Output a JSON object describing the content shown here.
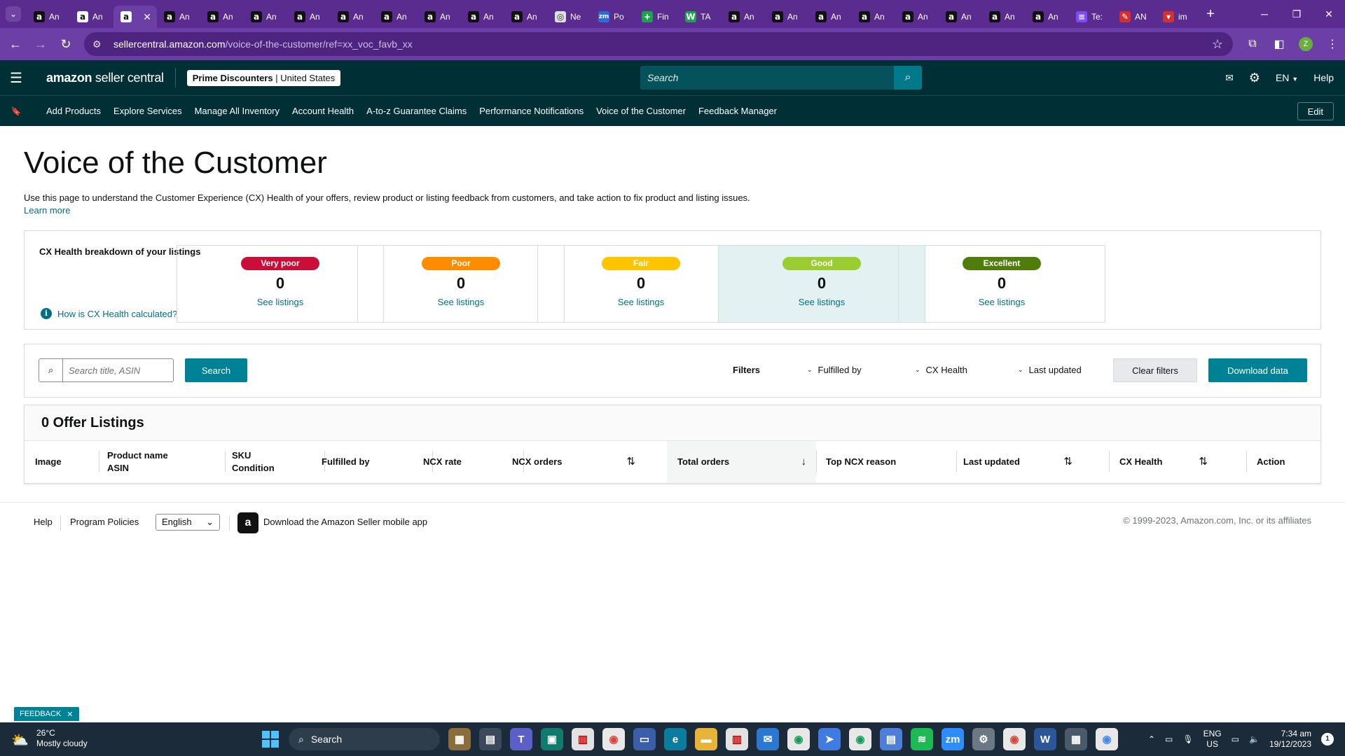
{
  "browser": {
    "tabs": [
      {
        "label": "An",
        "fav": "a",
        "style": "dark",
        "active": false
      },
      {
        "label": "An",
        "fav": "a",
        "style": "",
        "active": false
      },
      {
        "label": "",
        "fav": "a",
        "style": "",
        "active": true
      },
      {
        "label": "An",
        "fav": "a",
        "style": "dark",
        "active": false
      },
      {
        "label": "An",
        "fav": "a",
        "style": "dark",
        "active": false
      },
      {
        "label": "An",
        "fav": "a",
        "style": "dark",
        "active": false
      },
      {
        "label": "An",
        "fav": "a",
        "style": "dark",
        "active": false
      },
      {
        "label": "An",
        "fav": "a",
        "style": "dark",
        "active": false
      },
      {
        "label": "An",
        "fav": "a",
        "style": "dark",
        "active": false
      },
      {
        "label": "An",
        "fav": "a",
        "style": "dark",
        "active": false
      },
      {
        "label": "An",
        "fav": "a",
        "style": "dark",
        "active": false
      },
      {
        "label": "An",
        "fav": "a",
        "style": "dark",
        "active": false
      },
      {
        "label": "Ne",
        "fav": "◎",
        "style": "grey",
        "active": false
      },
      {
        "label": "Po",
        "fav": "zm",
        "style": "blue",
        "active": false
      },
      {
        "label": "Fin",
        "fav": "+",
        "style": "green",
        "active": false
      },
      {
        "label": "TA",
        "fav": "W",
        "style": "green",
        "active": false
      },
      {
        "label": "An",
        "fav": "a",
        "style": "dark",
        "active": false
      },
      {
        "label": "An",
        "fav": "a",
        "style": "dark",
        "active": false
      },
      {
        "label": "An",
        "fav": "a",
        "style": "dark",
        "active": false
      },
      {
        "label": "An",
        "fav": "a",
        "style": "dark",
        "active": false
      },
      {
        "label": "An",
        "fav": "a",
        "style": "dark",
        "active": false
      },
      {
        "label": "An",
        "fav": "a",
        "style": "dark",
        "active": false
      },
      {
        "label": "An",
        "fav": "a",
        "style": "dark",
        "active": false
      },
      {
        "label": "An",
        "fav": "a",
        "style": "dark",
        "active": false
      },
      {
        "label": "Te:",
        "fav": "≡",
        "style": "purple",
        "active": false
      },
      {
        "label": "AN",
        "fav": "✎",
        "style": "red",
        "active": false
      },
      {
        "label": "im",
        "fav": "▾",
        "style": "red",
        "active": false
      }
    ],
    "new_tab": "+",
    "url_host": "sellercentral.amazon.com",
    "url_path": "/voice-of-the-customer/ref=xx_voc_favb_xx",
    "profile_initial": "Z"
  },
  "header": {
    "logo_brand": "amazon",
    "logo_suffix": " seller central",
    "marketplace_store": "Prime Discounters",
    "marketplace_region": " | United States",
    "search_placeholder": "Search",
    "language": "EN",
    "help": "Help"
  },
  "nav": {
    "links": [
      "Add Products",
      "Explore Services",
      "Manage All Inventory",
      "Account Health",
      "A-to-z Guarantee Claims",
      "Performance Notifications",
      "Voice of the Customer",
      "Feedback Manager"
    ],
    "edit": "Edit"
  },
  "page": {
    "title": "Voice of the Customer",
    "description": "Use this page to understand the Customer Experience (CX) Health of your offers, review product or listing feedback from customers, and take action to fix product and listing issues.",
    "learn_more": "Learn more"
  },
  "cx_health": {
    "label": "CX Health breakdown of your listings",
    "how_link": "How is CX Health calculated?",
    "cards": [
      {
        "label": "Very poor",
        "count": "0",
        "link": "See listings",
        "color": "#cc0c39",
        "selected": false
      },
      {
        "label": "Poor",
        "count": "0",
        "link": "See listings",
        "color": "#ff8c00",
        "selected": false
      },
      {
        "label": "Fair",
        "count": "0",
        "link": "See listings",
        "color": "#ffc400",
        "selected": false
      },
      {
        "label": "Good",
        "count": "0",
        "link": "See listings",
        "color": "#9acd32",
        "selected": true
      },
      {
        "label": "Excellent",
        "count": "0",
        "link": "See listings",
        "color": "#4f7d0b",
        "selected": false
      }
    ]
  },
  "filters": {
    "search_placeholder": "Search title, ASIN",
    "search_button": "Search",
    "label": "Filters",
    "dropdowns": [
      "Fulfilled by",
      "CX Health",
      "Last updated"
    ],
    "clear": "Clear filters",
    "download": "Download data"
  },
  "listings": {
    "heading": "0 Offer Listings",
    "columns": [
      {
        "line1": "Image",
        "line2": ""
      },
      {
        "line1": "Product name",
        "line2": "ASIN"
      },
      {
        "line1": "SKU",
        "line2": "Condition"
      },
      {
        "line1": "Fulfilled by",
        "line2": ""
      },
      {
        "line1": "NCX rate",
        "line2": ""
      },
      {
        "line1": "NCX orders",
        "line2": "",
        "sort": "⇅"
      },
      {
        "line1": "Total orders",
        "line2": "",
        "sort": "↓"
      },
      {
        "line1": "Top NCX reason",
        "line2": ""
      },
      {
        "line1": "Last updated",
        "line2": "",
        "sort": "⇅"
      },
      {
        "line1": "CX Health",
        "line2": "",
        "sort": "⇅"
      },
      {
        "line1": "Action",
        "line2": ""
      }
    ]
  },
  "footer": {
    "help": "Help",
    "policies": "Program Policies",
    "language": "English",
    "app_text": "Download the Amazon Seller mobile app",
    "copyright": "© 1999-2023, Amazon.com, Inc. or its affiliates"
  },
  "feedback": "FEEDBACK",
  "taskbar": {
    "temperature": "26°C",
    "weather": "Mostly cloudy",
    "search": "Search",
    "lang_line1": "ENG",
    "lang_line2": "US",
    "time": "7:34 am",
    "date": "19/12/2023",
    "notifications": "1"
  }
}
